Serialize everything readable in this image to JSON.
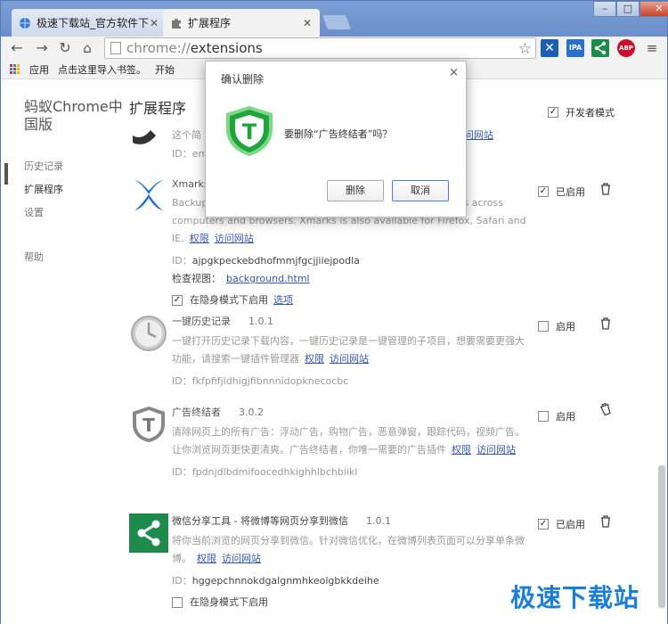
{
  "tabs": [
    {
      "label": "极速下载站_官方软件下载"
    },
    {
      "label": "扩展程序"
    }
  ],
  "window": {
    "minimize": "–",
    "maximize": "□",
    "close": "✕"
  },
  "toolbar": {
    "url_scheme": "chrome://",
    "url_path": "extensions",
    "extension_icons": [
      {
        "icon": "xmarks-icon",
        "color": "#1a5fb4"
      },
      {
        "icon": "ipa-icon",
        "color": "#2a6fc9",
        "text": "IPA"
      },
      {
        "icon": "share-icon",
        "color": "#1e8b4c"
      },
      {
        "icon": "abp-icon",
        "color": "#c8102e",
        "text": "ABP"
      }
    ],
    "menu_icon": "≡"
  },
  "bookmarks": {
    "apps": "应用",
    "import": "点击这里导入书签。",
    "start": "开始"
  },
  "sidebar": {
    "brand": "蚂蚁Chrome中国版",
    "items": [
      {
        "label": "历史记录"
      },
      {
        "label": "扩展程序"
      },
      {
        "label": "设置"
      },
      {
        "label": "帮助"
      }
    ]
  },
  "page": {
    "title": "扩展程序",
    "dev_mode": "开发者模式"
  },
  "extensions": [
    {
      "name": "",
      "desc_prefix": "这个简",
      "link_site": "访问网站",
      "id_label": "ID：",
      "id": "em"
    },
    {
      "name": "Xmarks",
      "desc": "Backup and sync your bookmarks, passwords and open tabs across computers and browsers. Xmarks is also available for Firefox, Safari and IE.",
      "link_perm": "权限",
      "link_site": "访问网站",
      "id_label": "ID：",
      "id": "ajpgkpeckebdhofmmjfgcjjiiejpodla",
      "inspect_label": "检查视图：",
      "inspect_link": "background.html",
      "incognito": "在隐身模式下启用",
      "options": "选项",
      "status": "已启用"
    },
    {
      "name": "一键历史记录",
      "version": "1.0.1",
      "desc": "一键打开历史记录下载内容，一键历史记录是一键管理的子项目，想要需要更强大功能，请搜索一键插件管理器",
      "link_perm": "权限",
      "link_site": "访问网站",
      "id_label": "ID：",
      "id": "fkfpfifjldhigjfibnnnidopknecocbc",
      "status": "启用"
    },
    {
      "name": "广告终结者",
      "version": "3.0.2",
      "desc": "清除网页上的所有广告：浮动广告，购物广告，恶意弹窗，跟踪代码，视频广告。让你浏览网页更快更清爽。广告终结者，你唯一需要的广告插件",
      "link_perm": "权限",
      "link_site": "访问网站",
      "id_label": "ID：",
      "id": "fpdnjdlbdmifoocedhkighhlbchbiikl",
      "status": "启用"
    },
    {
      "name": "微信分享工具 - 将微博等网页分享到微信",
      "version": "1.0.1",
      "desc": "将你当前浏览的网页分享到微信。针对微信优化，在微博列表页面可以分享单条微博。",
      "link_perm": "权限",
      "link_site": "访问网站",
      "id_label": "ID：",
      "id": "hggepchnnokdgalgnmhkeolgbkkdeihe",
      "incognito": "在隐身模式下启用",
      "status": "已启用"
    }
  ],
  "dialog": {
    "title": "确认删除",
    "message": "要删除“广告终结者”吗？",
    "delete": "删除",
    "cancel": "取消",
    "close": "×"
  },
  "watermark": "极速下载站",
  "colors": {
    "link": "#3657ad",
    "dialog_icon": "#1fa53b",
    "titlebar": "#6b8fcb"
  }
}
